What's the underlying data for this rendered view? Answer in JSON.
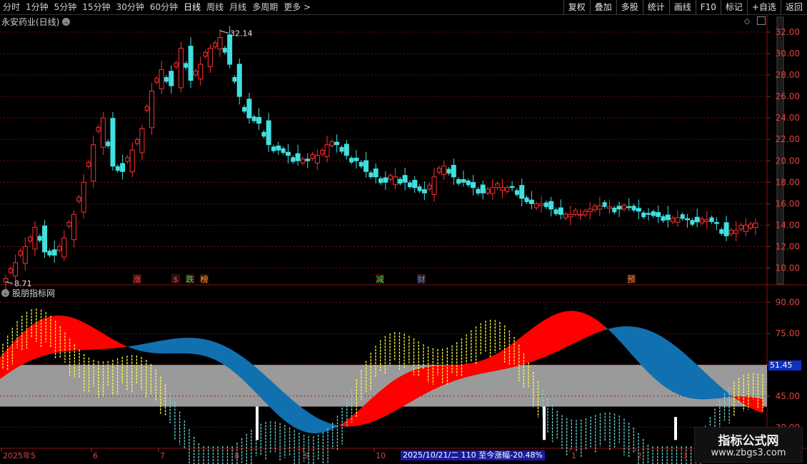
{
  "toolbar": {
    "periods": [
      "分时",
      "1分钟",
      "5分钟",
      "15分钟",
      "30分钟",
      "60分钟",
      "日线",
      "周线",
      "月线",
      "多周期",
      "更多 >"
    ],
    "active_period": "日线",
    "buttons": [
      "复权",
      "叠加",
      "多股",
      "统计",
      "画线",
      "F10",
      "标记",
      "+自选",
      "返回"
    ]
  },
  "main_panel": {
    "title": "永安药业(日线)",
    "high_label": "32.14",
    "low_label": "8.71",
    "price_axis": [
      "32.00",
      "30.00",
      "28.00",
      "26.00",
      "24.00",
      "22.00",
      "20.00",
      "18.00",
      "16.00",
      "14.00",
      "12.00",
      "10.00"
    ],
    "event_markers": [
      {
        "text": "涨",
        "color": "#ff4040"
      },
      {
        "text": "$",
        "color": "#ff4040"
      },
      {
        "text": "跌",
        "color": "#40e040"
      },
      {
        "text": "榜",
        "color": "#ffa020"
      },
      {
        "text": "减",
        "color": "#40e040"
      },
      {
        "text": "财",
        "color": "#40a0ff"
      },
      {
        "text": "预",
        "color": "#ffa020"
      }
    ]
  },
  "indicator_panel": {
    "title": "股朋指标网",
    "axis": [
      "90.00",
      "75.00",
      "60.00",
      "45.00",
      "30.00"
    ],
    "cursor_value": "51.45"
  },
  "time_axis": [
    "2025年5",
    "6",
    "7",
    "8",
    "9",
    "10",
    "1",
    "2",
    "3"
  ],
  "date_readout": "2025/10/21/二 110 至今涨幅-20.48%",
  "watermark": {
    "title": "指标公式网",
    "url": "www.zbgs3.com"
  },
  "colors": {
    "up": "#ff3030",
    "down": "#40e0e0",
    "band": "#9a9a9a",
    "cloud_red": "#ff0000",
    "cloud_blue": "#1070b0",
    "osc_yellow": "#ffff40",
    "osc_cyan": "#70d8d8",
    "grid": "#8a1010"
  },
  "chart_data": [
    {
      "type": "candlestick",
      "title": "永安药业(日线)",
      "ylim": [
        8.5,
        33
      ],
      "close_series_approx": [
        9.0,
        10.5,
        12.0,
        13.8,
        11.5,
        11.2,
        12.8,
        15.0,
        18.0,
        21.5,
        24.0,
        19.5,
        19.0,
        21.0,
        23.0,
        26.5,
        28.5,
        27.0,
        30.5,
        27.5,
        29.0,
        30.5,
        31.5,
        29.0,
        26.0,
        24.0,
        23.5,
        21.5,
        21.0,
        20.5,
        20.0,
        20.0,
        20.5,
        21.5,
        21.5,
        20.5,
        20.0,
        19.0,
        18.5,
        18.0,
        18.5,
        18.0,
        17.5,
        17.0,
        18.5,
        19.5,
        18.5,
        18.0,
        17.5,
        17.0,
        17.5,
        17.5,
        17.5,
        16.5,
        16.0,
        16.0,
        15.5,
        15.0,
        15.0,
        15.0,
        15.5,
        15.8,
        15.7,
        15.5,
        15.7,
        15.3,
        15.0,
        14.8,
        14.5,
        14.7,
        14.5,
        14.3,
        14.5,
        14.2,
        13.0,
        13.5,
        14.0,
        14.2
      ],
      "annotations": [
        "32.14",
        "8.71"
      ]
    },
    {
      "type": "line",
      "title": "股朋指标网",
      "ylim": [
        20,
        98
      ],
      "band": [
        40,
        60
      ],
      "current_value": 51.45
    }
  ]
}
